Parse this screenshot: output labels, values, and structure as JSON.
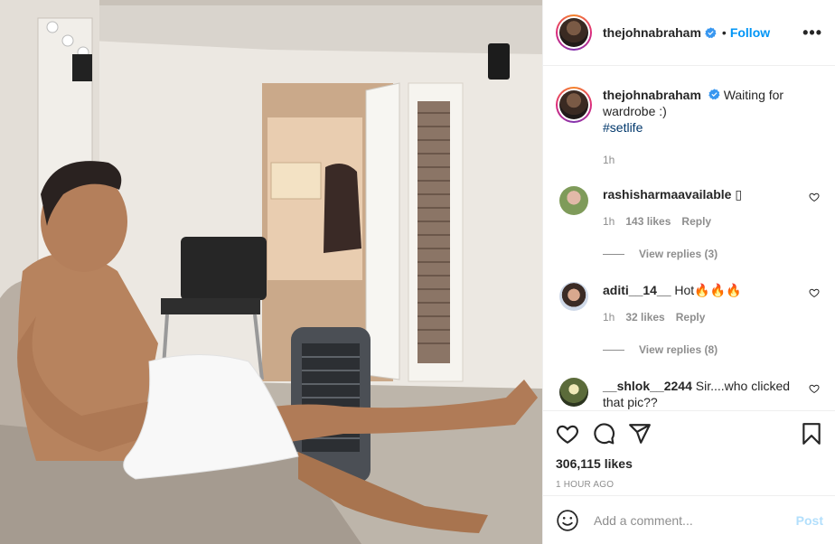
{
  "post": {
    "username": "thejohnabraham",
    "follow_label": "Follow",
    "dot": "•",
    "more": "•••",
    "caption": {
      "username": "thejohnabraham",
      "text": "Waiting for wardrobe :)",
      "hashtag": "#setlife",
      "time": "1h"
    },
    "comments": [
      {
        "username": "rashisharmaavailable",
        "text": "▯",
        "time": "1h",
        "likes": "143 likes",
        "reply_label": "Reply",
        "view_replies": "View replies (3)"
      },
      {
        "username": "aditi__14__",
        "text": "Hot🔥🔥🔥",
        "time": "1h",
        "likes": "32 likes",
        "reply_label": "Reply",
        "view_replies": "View replies (8)"
      },
      {
        "username": "__shlok__2244",
        "text": "Sir....who clicked that pic??"
      }
    ],
    "likes": "306,115 likes",
    "time_ago": "1 HOUR AGO",
    "add_comment_placeholder": "Add a comment...",
    "post_label": "Post"
  },
  "colors": {
    "accent": "#0095f6",
    "muted": "#8e8e8e",
    "text": "#262626",
    "post_disabled": "#b2dffc"
  },
  "icons": [
    "verified-badge-icon",
    "more-icon",
    "heart-icon",
    "comment-icon",
    "share-icon",
    "bookmark-icon",
    "smiley-icon"
  ]
}
